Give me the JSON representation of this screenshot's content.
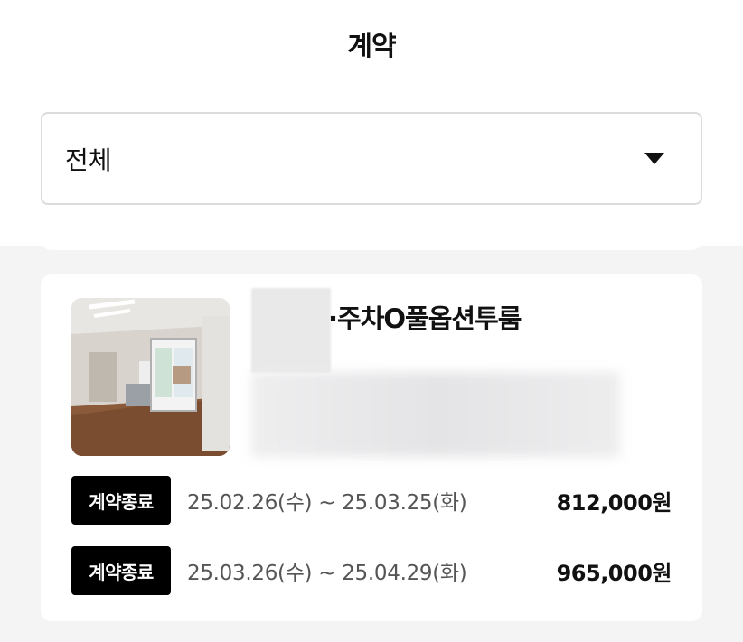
{
  "header": {
    "title": "계약"
  },
  "filter": {
    "selected": "전체",
    "icon": "caret-down-icon"
  },
  "contract_card": {
    "listing_title": "·주차O풀옵션투룸",
    "contracts": [
      {
        "status": "계약종료",
        "period": "25.02.26(수) ~ 25.03.25(화)",
        "amount": "812,000원"
      },
      {
        "status": "계약종료",
        "period": "25.03.26(수) ~ 25.04.29(화)",
        "amount": "965,000원"
      }
    ]
  }
}
